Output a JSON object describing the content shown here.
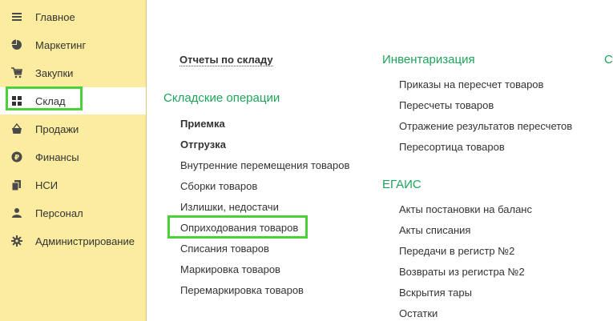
{
  "sidebar": {
    "items": [
      {
        "label": "Главное",
        "icon": "menu-lines-icon"
      },
      {
        "label": "Маркетинг",
        "icon": "pie-chart-icon"
      },
      {
        "label": "Закупки",
        "icon": "cart-icon"
      },
      {
        "label": "Склад",
        "icon": "grid-icon"
      },
      {
        "label": "Продажи",
        "icon": "basket-icon"
      },
      {
        "label": "Финансы",
        "icon": "ruble-coin-icon"
      },
      {
        "label": "НСИ",
        "icon": "documents-icon"
      },
      {
        "label": "Персонал",
        "icon": "person-icon"
      },
      {
        "label": "Администрирование",
        "icon": "gear-icon"
      }
    ]
  },
  "main": {
    "reports_link": "Отчеты по складу",
    "warehouse_ops": {
      "heading": "Складские операции",
      "items": [
        "Приемка",
        "Отгрузка",
        "Внутренние перемещения товаров",
        "Сборки товаров",
        "Излишки, недостачи",
        "Оприходования товаров",
        "Списания товаров",
        "Маркировка товаров",
        "Перемаркировка товаров"
      ]
    },
    "inventory": {
      "heading": "Инвентаризация",
      "items": [
        "Приказы на пересчет товаров",
        "Пересчеты товаров",
        "Отражение результатов пересчетов",
        "Пересортица товаров"
      ]
    },
    "egais": {
      "heading": "ЕГАИС",
      "items": [
        "Акты постановки на баланс",
        "Акты списания",
        "Передачи в регистр №2",
        "Возвраты из регистра №2",
        "Вскрытия тары",
        "Остатки"
      ]
    },
    "cut_heading": "С"
  },
  "colors": {
    "sidebar_bg": "#fbec9f",
    "heading_green": "#1ea45a",
    "highlight_green": "#4cd13a"
  }
}
